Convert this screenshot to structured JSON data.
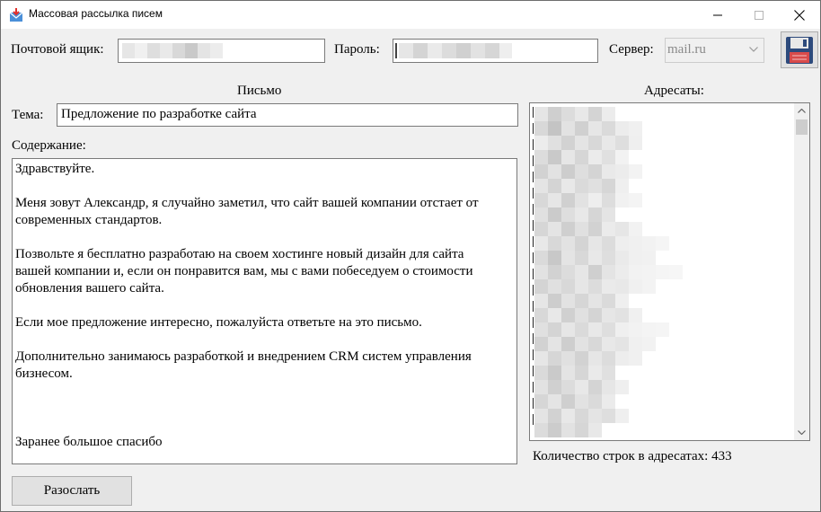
{
  "window": {
    "title": "Массовая рассылка писем"
  },
  "account": {
    "mailbox_label": "Почтовой ящик:",
    "password_label": "Пароль:",
    "server_label": "Сервер:",
    "server_value": "mail.ru"
  },
  "letter": {
    "section_label": "Письмо",
    "subject_label": "Тема:",
    "subject_value": "Предложение по разработке сайта",
    "content_label": "Содержание:",
    "content_lines": [
      "Здравствуйте.",
      "",
      "Меня зовут Александр, я случайно заметил, что сайт вашей компании отстает от",
      "современных стандартов.",
      "",
      "Позвольте я бесплатно разработаю на своем хостинге новый дизайн для сайта",
      "вашей компании и, если он понравится вам, мы с вами побеседуем о стоимости",
      "обновления вашего сайта.",
      "",
      "Если мое предложение интересно, пожалуйста ответьте на это письмо.",
      "",
      "Дополнительно занимаюсь разработкой и внедрением CRM систем управления",
      "бизнесом.",
      "",
      "",
      "",
      "Заранее большое спасибо"
    ]
  },
  "recipients": {
    "section_label": "Адресаты:",
    "count_label": "Количество строк в адресатах: 433"
  },
  "actions": {
    "send_label": "Разослать"
  }
}
